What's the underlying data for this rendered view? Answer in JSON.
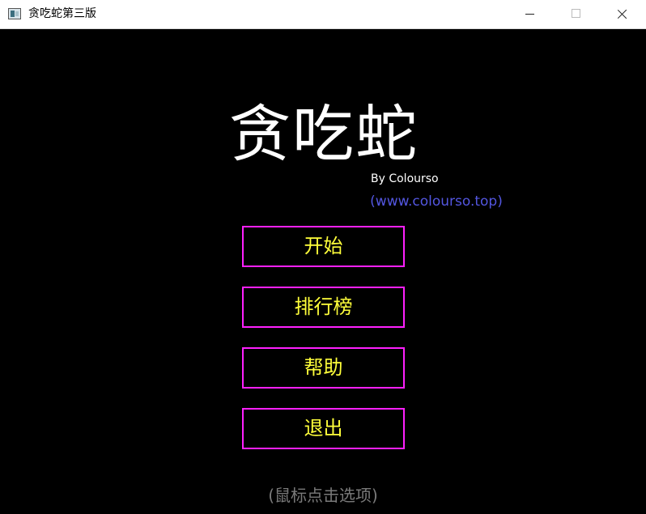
{
  "window": {
    "title": "贪吃蛇第三版",
    "icon": "app-window-icon",
    "controls": [
      "minimize-icon",
      "maximize-icon",
      "close-icon"
    ]
  },
  "game": {
    "title": "贪吃蛇",
    "author": "By Colourso",
    "website": "(www.colourso.top)",
    "menu": {
      "start": "开始",
      "leaderboard": "排行榜",
      "help": "帮助",
      "exit": "退出"
    },
    "hint": "(鼠标点击选项)"
  },
  "colors": {
    "background": "#000000",
    "title_text": "#ffffff",
    "website_text": "#5356e0",
    "button_border": "#ff20ff",
    "button_text": "#ffff3a",
    "hint_text": "#7a7a7a"
  }
}
